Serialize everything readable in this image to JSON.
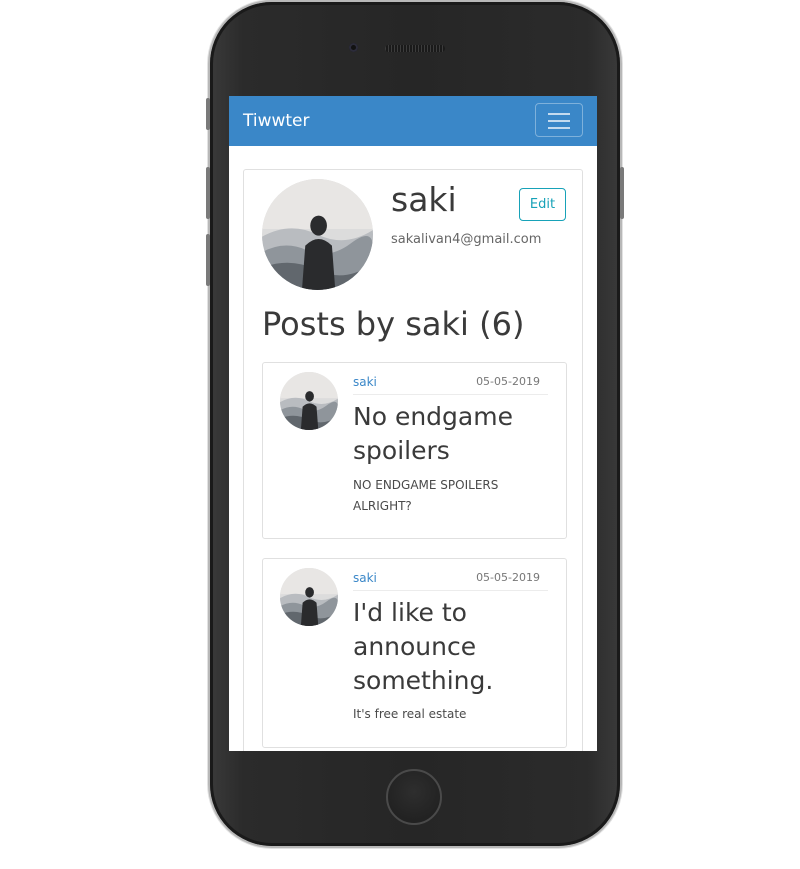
{
  "navbar": {
    "brand": "Tiwwter",
    "menu_icon": "hamburger-menu-icon"
  },
  "profile": {
    "username": "saki",
    "email": "sakalivan4@gmail.com",
    "edit_label": "Edit",
    "avatar_icon": "user-avatar-hooded-figure"
  },
  "posts_heading": "Posts by saki (6)",
  "posts": [
    {
      "author": "saki",
      "date": "05-05-2019",
      "title": "No endgame spoilers",
      "body": "NO ENDGAME SPOILERS ALRIGHT?"
    },
    {
      "author": "saki",
      "date": "05-05-2019",
      "title": "I'd like to announce something.",
      "body": "It's free real estate"
    }
  ],
  "colors": {
    "navbar": "#3a87c8",
    "edit_button": "#17a2b8",
    "author_link": "#3a87c8",
    "device_body": "#262626"
  }
}
